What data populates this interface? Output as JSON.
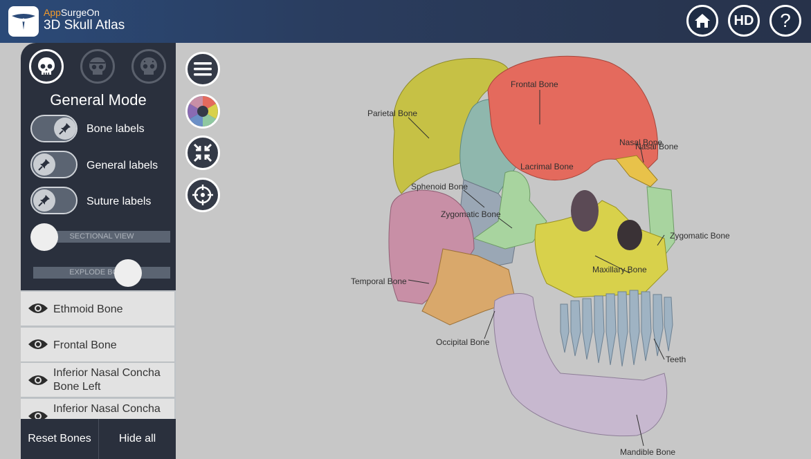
{
  "header": {
    "brand_part1": "App",
    "brand_part2": "SurgeOn",
    "app_title": "3D Skull Atlas",
    "hd_label": "HD",
    "help_label": "?",
    "logo_icon": "scissors-logo-icon",
    "home_icon": "home-icon"
  },
  "panel": {
    "mode_title": "General Mode",
    "toggles": [
      {
        "label": "Bone labels",
        "on": true
      },
      {
        "label": "General labels",
        "on": false
      },
      {
        "label": "Suture labels",
        "on": false
      }
    ],
    "sectional_view_label": "SECTIONAL VIEW",
    "explode_label": "EXPLODE BONES",
    "sectional_value": 0,
    "explode_value": 0.68
  },
  "bone_list": [
    {
      "name": "Ethmoid Bone"
    },
    {
      "name": "Frontal Bone"
    },
    {
      "name": "Inferior Nasal Concha Bone Left"
    },
    {
      "name": "Inferior Nasal Concha"
    }
  ],
  "buttons": {
    "reset": "Reset Bones",
    "hide_all": "Hide all"
  },
  "labels": {
    "frontal": "Frontal Bone",
    "parietal": "Parietal Bone",
    "nasal1": "Nasal Bone",
    "nasal2": "Nasal Bone",
    "lacrimal": "Lacrimal Bone",
    "sphenoid": "Sphenoid Bone",
    "zygomatic_left": "Zygomatic Bone",
    "zygomatic_right": "Zygomatic Bone",
    "maxillary": "Maxillary Bone",
    "temporal": "Temporal Bone",
    "occipital": "Occipital Bone",
    "teeth": "Teeth",
    "mandible": "Mandible Bone"
  },
  "colors": {
    "frontal": "#e46a5d",
    "parietal": "#c6c145",
    "sphenoid": "#8fb7ad",
    "zygomatic": "#a8d49f",
    "maxillary": "#d8d14b",
    "temporal": "#c88fa6",
    "occipital": "#d9a86b",
    "mandible": "#c7b8cf",
    "teeth": "#9fb3c3",
    "accent_orange": "#f39a2b"
  }
}
